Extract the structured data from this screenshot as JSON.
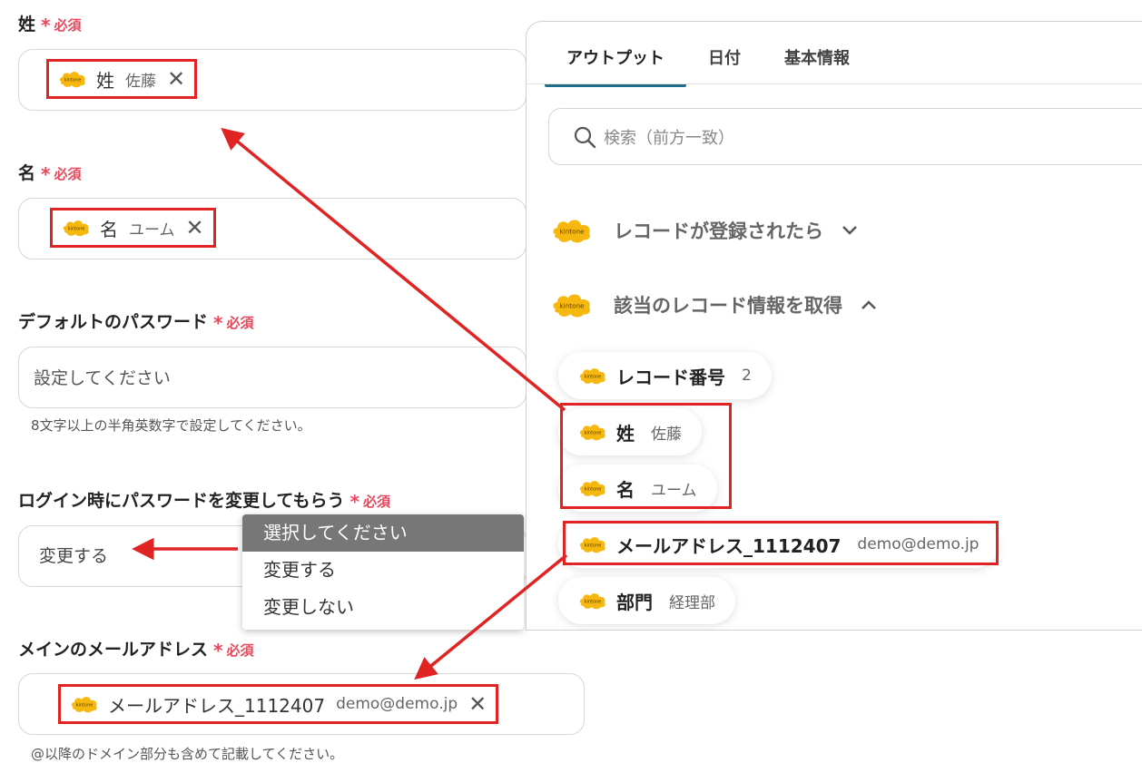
{
  "form": {
    "last_name": {
      "label": "姓",
      "required": "必須",
      "chip_name": "姓",
      "chip_value": "佐藤"
    },
    "first_name": {
      "label": "名",
      "required": "必須",
      "chip_name": "名",
      "chip_value": "ユーム"
    },
    "password": {
      "label": "デフォルトのパスワード",
      "required": "必須",
      "placeholder": "設定してください",
      "hint": "8文字以上の半角英数字で設定してください。"
    },
    "change_password": {
      "label": "ログイン時にパスワードを変更してもらう",
      "required": "必須",
      "value": "変更する"
    },
    "email": {
      "label": "メインのメールアドレス",
      "required": "必須",
      "chip_name": "メールアドレス_1112407",
      "chip_value": "demo@demo.jp",
      "hint": "@以降のドメイン部分も含めて記載してください。"
    }
  },
  "dropdown": {
    "options": [
      "選択してください",
      "変更する",
      "変更しない"
    ],
    "selected": "選択してください"
  },
  "panel": {
    "tabs": [
      "アウトプット",
      "日付",
      "基本情報"
    ],
    "active_tab": "アウトプット",
    "search_placeholder": "検索（前方一致）",
    "sections": [
      {
        "title": "レコードが登録されたら",
        "expanded": false
      },
      {
        "title": "該当のレコード情報を取得",
        "expanded": true
      }
    ],
    "outputs": [
      {
        "name": "レコード番号",
        "value": "2"
      },
      {
        "name": "姓",
        "value": "佐藤"
      },
      {
        "name": "名",
        "value": "ユーム"
      },
      {
        "name": "メールアドレス_1112407",
        "value": "demo@demo.jp"
      },
      {
        "name": "部門",
        "value": "経理部"
      }
    ]
  },
  "colors": {
    "required": "#e8465a",
    "highlight": "#e02424",
    "tab_accent": "#1f6f8b",
    "kintone": "#f6b80f"
  },
  "icons": {
    "app_logo": "kintone-logo-icon",
    "remove": "close-icon",
    "search": "search-icon",
    "collapsed": "chevron-down-icon",
    "expanded": "chevron-up-icon"
  }
}
